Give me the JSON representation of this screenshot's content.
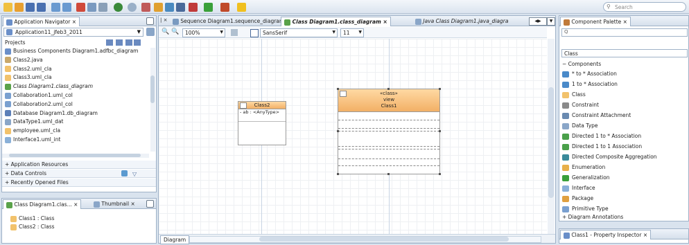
{
  "search": {
    "placeholder": "Search"
  },
  "app_nav": {
    "tab": "Application Navigator",
    "app_selector": "Application11_jfeb3_2011",
    "projects_label": "Projects",
    "items": [
      {
        "label": "Business Components Diagram1.adfbc_diagram",
        "icon": "bc-diagram-icon",
        "color": "#6a8fc9"
      },
      {
        "label": "Class2.java",
        "icon": "java-file-icon",
        "color": "#c9a86a"
      },
      {
        "label": "Class2.uml_cla",
        "icon": "uml-class-icon",
        "color": "#f2c26b"
      },
      {
        "label": "Class3.uml_cla",
        "icon": "uml-class-icon",
        "color": "#f2c26b"
      },
      {
        "label": "Class Diagram1.class_diagram",
        "icon": "class-diagram-icon",
        "color": "#5aa24a",
        "italic": true
      },
      {
        "label": "Collaboration1.uml_col",
        "icon": "collaboration-icon",
        "color": "#7aa0d0"
      },
      {
        "label": "Collaboration2.uml_col",
        "icon": "collaboration-icon",
        "color": "#7aa0d0"
      },
      {
        "label": "Database Diagram1.db_diagram",
        "icon": "db-diagram-icon",
        "color": "#5c7fb8"
      },
      {
        "label": "DataType1.uml_dat",
        "icon": "datatype-icon",
        "color": "#8aa6c8"
      },
      {
        "label": "employee.uml_cla",
        "icon": "uml-class-icon",
        "color": "#f2c26b"
      },
      {
        "label": "Interface1.uml_int",
        "icon": "interface-icon",
        "color": "#8ab0d8"
      }
    ],
    "sections": [
      "Application Resources",
      "Data Controls",
      "Recently Opened Files"
    ]
  },
  "structure": {
    "tab1": "Class Diagram1.clas...",
    "tab2": "Thumbnail",
    "items": [
      "Class1 : Class",
      "Class2 : Class"
    ]
  },
  "editor": {
    "tabs": [
      {
        "label": "Sequence Diagram1.sequence_diagram"
      },
      {
        "label": "Class Diagram1.class_diagram",
        "selected": true
      },
      {
        "label": "Java Class Diagram1.java_diagra"
      }
    ],
    "zoom": "100%",
    "font": "SansSerif",
    "font_size": "11",
    "bottom_tab": "Diagram",
    "class2": {
      "name": "Class2",
      "attr": "- ab : <AnyType>"
    },
    "class1": {
      "stereotype": "«class»",
      "package": "view",
      "name": "Class1"
    }
  },
  "palette": {
    "tab": "Component Palette",
    "category": "Class",
    "section": "Components",
    "items": [
      {
        "label": "* to * Association",
        "icon": "assoc-icon",
        "color": "#4a8ac9"
      },
      {
        "label": "1 to * Association",
        "icon": "assoc-icon",
        "color": "#4a8ac9"
      },
      {
        "label": "Class",
        "icon": "class-icon",
        "color": "#f2c26b"
      },
      {
        "label": "Constraint",
        "icon": "constraint-icon",
        "color": "#8a8a8a"
      },
      {
        "label": "Constraint Attachment",
        "icon": "constraint-attach-icon",
        "color": "#6a8ab0"
      },
      {
        "label": "Data Type",
        "icon": "datatype-icon",
        "color": "#8aa6c8"
      },
      {
        "label": "Directed 1 to * Association",
        "icon": "directed-assoc-icon",
        "color": "#4aa04a"
      },
      {
        "label": "Directed 1 to 1 Association",
        "icon": "directed-assoc-icon",
        "color": "#4aa04a"
      },
      {
        "label": "Directed Composite Aggregation",
        "icon": "composite-icon",
        "color": "#3a8a9a"
      },
      {
        "label": "Enumeration",
        "icon": "enum-icon",
        "color": "#e8b04a"
      },
      {
        "label": "Generalization",
        "icon": "generalization-icon",
        "color": "#3aa03a"
      },
      {
        "label": "Interface",
        "icon": "interface-icon",
        "color": "#8ab0d8"
      },
      {
        "label": "Package",
        "icon": "package-icon",
        "color": "#e0a040"
      },
      {
        "label": "Primitive Type",
        "icon": "primitive-icon",
        "color": "#7aa0d0"
      }
    ],
    "annotations": "Diagram Annotations"
  },
  "inspector": {
    "tab": "Class1 - Property Inspector"
  }
}
